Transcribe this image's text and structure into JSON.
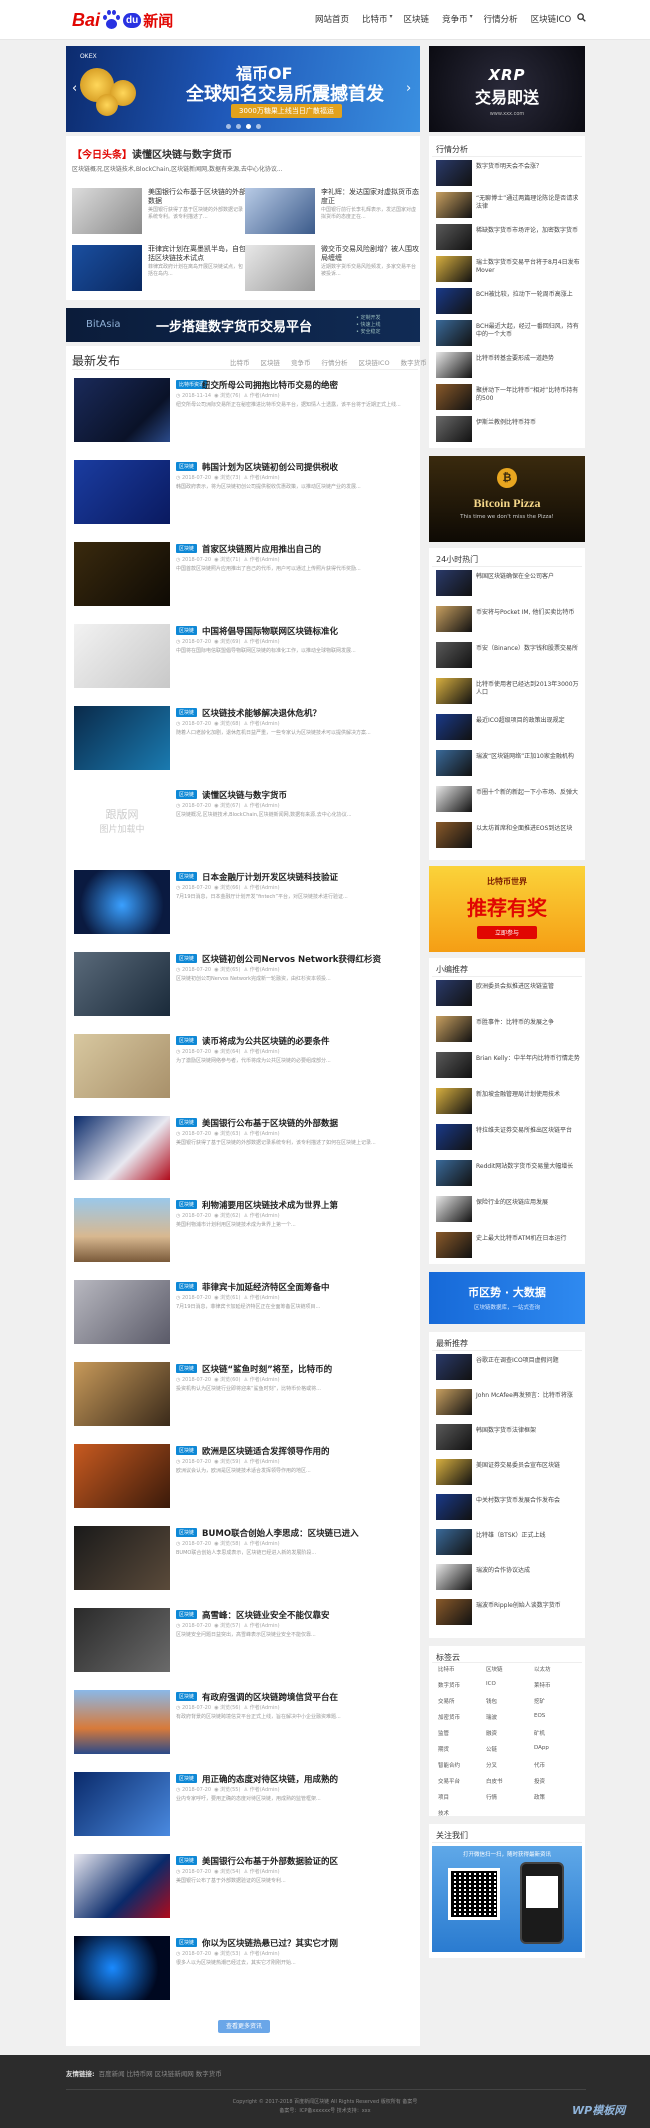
{
  "header": {
    "logo": {
      "bai": "Bai",
      "du": "du",
      "xw": "新闻"
    },
    "nav": [
      "网站首页",
      "比特币",
      "区块链",
      "竞争币",
      "行情分析",
      "区块链ICO"
    ],
    "nav_has_dropdown": [
      false,
      true,
      false,
      true,
      false,
      false
    ]
  },
  "hero": {
    "brand": "OKEX",
    "line1": "福币OF",
    "line2": "全球知名交易所震撼首发",
    "line3": "3000万糖果上线当日广散福运"
  },
  "xrp_ad": {
    "line1": "XRP",
    "line2": "交易即送",
    "line3": "www.xxx.com"
  },
  "headline": {
    "tag": "【今日头条】",
    "title": "读懂区块链与数字货币",
    "desc": "区块链概况,区块链技术,BlockChain,区块链新闻网,数据有来源,去中心化协议..."
  },
  "featured": [
    {
      "title": "美国银行公布基于区块链的外部数据",
      "desc": "美国银行获得了基于区块链的外部数据记录系统专利。该专利描述了..."
    },
    {
      "title": "李礼辉：发达国家对虚拟货币态度正",
      "desc": "中国银行前行长李礼辉表示，发达国家对虚拟货币的态度正在..."
    },
    {
      "title": "菲律宾计划在离墨凯半岛，自包括区块链技术试点",
      "desc": "菲律宾政府计划在离岛开展区块链试点，包括在岛内..."
    },
    {
      "title": "微交币交易风险剧增？被人围攻局缠缠",
      "desc": "近期数字货币交易风险频发，多家交易平台被投诉..."
    }
  ],
  "bitasia": {
    "brand": "BitAsia",
    "slogan": "一步搭建数字货币交易平台",
    "notes": "• 定制开发\n• 快速上线\n• 安全稳定"
  },
  "latest": {
    "title": "最新发布",
    "tabs": [
      "比特币",
      "区块链",
      "竞争币",
      "行情分析",
      "区块链ICO",
      "数字货币"
    ],
    "more_button": "查看更多资讯"
  },
  "articles": [
    {
      "cat": "比特币资讯",
      "title": "纽交所母公司拥抱比特币交易的绝密",
      "date": "2018-11-14",
      "views": "浏览(76)",
      "author": "作者(Admin)",
      "excerpt": "纽交所母公司洲际交易所正在秘密推进比特币交易平台，据知情人士透露，该平台将于近期正式上线..."
    },
    {
      "cat": "区块链",
      "title": "韩国计划为区块链初创公司提供税收",
      "date": "2018-07-20",
      "views": "浏览(73)",
      "author": "作者(Admin)",
      "excerpt": "韩国政府表示，将为区块链初创公司提供税收优惠政策，以推动区块链产业的发展..."
    },
    {
      "cat": "区块链",
      "title": "首家区块链照片应用推出自己的",
      "date": "2018-07-20",
      "views": "浏览(71)",
      "author": "作者(Admin)",
      "excerpt": "中国首款区块链照片应用推出了自己的代币，用户可以通过上传照片获得代币奖励..."
    },
    {
      "cat": "区块链",
      "title": "中国将倡导国际物联网区块链标准化",
      "date": "2018-07-20",
      "views": "浏览(69)",
      "author": "作者(Admin)",
      "excerpt": "中国将在国际电信联盟倡导物联网区块链的标准化工作，以推动全球物联网发展..."
    },
    {
      "cat": "区块链",
      "title": "区块链技术能够解决退休危机？",
      "date": "2018-07-20",
      "views": "浏览(68)",
      "author": "作者(Admin)",
      "excerpt": "随着人口老龄化加剧，退休危机日益严重，一些专家认为区块链技术可以提供解决方案..."
    },
    {
      "cat": "区块链",
      "title": "读懂区块链与数字货币",
      "date": "2018-07-20",
      "views": "浏览(67)",
      "author": "作者(Admin)",
      "excerpt": "区块链概况,区块链技术,BlockChain,区块链新闻网,数据有来源,去中心化协议..."
    },
    {
      "cat": "区块链",
      "title": "日本金融厅计划开发区块链科技验证",
      "date": "2018-07-20",
      "views": "浏览(66)",
      "author": "作者(Admin)",
      "excerpt": "7月19日消息，日本金融厅计划开发“fintech”平台，对区块链技术进行验证..."
    },
    {
      "cat": "区块链",
      "title": "区块链初创公司Nervos Network获得红杉资",
      "date": "2018-07-20",
      "views": "浏览(65)",
      "author": "作者(Admin)",
      "excerpt": "区块链初创公司Nervos Network完成新一轮融资，由红杉资本领投..."
    },
    {
      "cat": "区块链",
      "title": "读币将成为公共区块链的必要条件",
      "date": "2018-07-20",
      "views": "浏览(64)",
      "author": "作者(Admin)",
      "excerpt": "为了激励区块链网络参与者，代币将成为公共区块链的必要组成部分..."
    },
    {
      "cat": "区块链",
      "title": "美国银行公布基于区块链的外部数据",
      "date": "2018-07-20",
      "views": "浏览(63)",
      "author": "作者(Admin)",
      "excerpt": "美国银行获得了基于区块链的外部数据记录系统专利，该专利描述了如何在区块链上记录..."
    },
    {
      "cat": "区块链",
      "title": "利物浦要用区块链技术成为世界上第",
      "date": "2018-07-20",
      "views": "浏览(62)",
      "author": "作者(Admin)",
      "excerpt": "英国利物浦市计划利用区块链技术成为世界上第一个..."
    },
    {
      "cat": "区块链",
      "title": "菲律宾卡加延经济特区全面筹备中",
      "date": "2018-07-20",
      "views": "浏览(61)",
      "author": "作者(Admin)",
      "excerpt": "7月19日消息，菲律宾卡加延经济特区正在全面筹备区块链项目..."
    },
    {
      "cat": "区块链",
      "title": "区块链“鲨鱼时刻”将至，比特币的",
      "date": "2018-07-20",
      "views": "浏览(60)",
      "author": "作者(Admin)",
      "excerpt": "投资机构认为区块链行业即将迎来“鲨鱼时刻”，比特币价格或将..."
    },
    {
      "cat": "区块链",
      "title": "欧洲是区块链适合发挥领导作用的",
      "date": "2018-07-20",
      "views": "浏览(59)",
      "author": "作者(Admin)",
      "excerpt": "欧洲议会认为，欧洲是区块链技术适合发挥领导作用的地区..."
    },
    {
      "cat": "区块链",
      "title": "BUMO联合创始人李思成：区块链已进入",
      "date": "2018-07-20",
      "views": "浏览(58)",
      "author": "作者(Admin)",
      "excerpt": "BUMO联合创始人李思成表示，区块链已经进入新的发展阶段..."
    },
    {
      "cat": "区块链",
      "title": "高雪峰：区块链业安全不能仅靠安",
      "date": "2018-07-20",
      "views": "浏览(57)",
      "author": "作者(Admin)",
      "excerpt": "区块链安全问题日益突出，高雪峰表示区块链业安全不能仅靠..."
    },
    {
      "cat": "区块链",
      "title": "有政府强调的区块链跨境信贷平台在",
      "date": "2018-07-20",
      "views": "浏览(56)",
      "author": "作者(Admin)",
      "excerpt": "有政府背景的区块链跨境信贷平台正式上线，旨在解决中小企业融资难题..."
    },
    {
      "cat": "区块链",
      "title": "用正确的态度对待区块链，用成熟的",
      "date": "2018-07-20",
      "views": "浏览(55)",
      "author": "作者(Admin)",
      "excerpt": "业内专家呼吁，要用正确的态度对待区块链，用成熟的监管框架..."
    },
    {
      "cat": "区块链",
      "title": "美国银行公布基于外部数据验证的区",
      "date": "2018-07-20",
      "views": "浏览(54)",
      "author": "作者(Admin)",
      "excerpt": "美国银行公布了基于外部数据验证的区块链专利..."
    },
    {
      "cat": "区块链",
      "title": "你以为区块链热悬已过？其实它才刚",
      "date": "2018-07-20",
      "views": "浏览(53)",
      "author": "作者(Admin)",
      "excerpt": "很多人以为区块链热潮已经过去，其实它才刚刚开始..."
    }
  ],
  "sidebar": {
    "market_title": "行情分析",
    "market": [
      "数字货币明天会不会涨？",
      "“无聊博士”通过两篇理论陈论是否请求法律",
      "稀缺数字货币市场评论，加密数字货币",
      "瑞士数字货币交易平台将于8月4日发布Mover",
      "BCH被比较，拉动下一轮周币高涨上",
      "BCH最近大起，经过一番回归风，持有中的一个大币",
      "比特币转基金要形成一道趋势",
      "聚拼动下一年比特币“相对”比特币持有的500",
      "伊斯兰教例比特币持币"
    ],
    "pizza": {
      "title": "Bitcoin Pizza",
      "sub": "This time we don't miss the Pizza!"
    },
    "hot_title": "24小时热门",
    "hot": [
      "韩国区块链确保在全公司客户",
      "币安将与Pocket IM, 他们买卖比特币",
      "币安（Binance）数字钱和股票交易所",
      "比特币使用者已经达到2013年3000万人口",
      "最近ICO超级项目的政策出现规定",
      "瑞波“区块链网络”正加10家金融机构",
      "币圈十个新的新起一下小市场、反弹大",
      "以太坊首席和全面推进EOS到达区块"
    ],
    "promo": {
      "top": "比特币世界",
      "main": "推荐有奖",
      "sub": "立即参与"
    },
    "news_title": "小编推荐",
    "news": [
      "欧洲委员会拟推进区块链监管",
      "币胜事件：比特币的发展之争",
      "Brian Kelly：中半年内比特币行情走势",
      "新加坡金融管理局计划使用技术",
      "特拉维夫证券交易所推出区块链平台",
      "Reddit网站数字货币交易量大幅增长",
      "保险行业的区块链应用发展",
      "史上最大比特币ATM机在日本运行"
    ],
    "blue_banner": {
      "title": "币区势 · 大数据",
      "sub": "区块链数据库，一站式查询"
    },
    "recent_title": "最新推荐",
    "recent": [
      "谷歌正在调查ICO项目虚假问题",
      "John McAfee再发预言：比特币将涨",
      "韩国数字货币法律框架",
      "美国证券交易委员会宣布区块链",
      "中关村数字货币发展合作发布会",
      "比特雄（BTSK）正式上线",
      "瑞波的合作协议达成",
      "瑞波币Ripple创始人谈数字货币"
    ],
    "tags_title": "标签云",
    "tags": [
      "比特币",
      "区块链",
      "以太坊",
      "数字货币",
      "ICO",
      "莱特币",
      "交易所",
      "钱包",
      "挖矿",
      "加密货币",
      "瑞波",
      "EOS",
      "监管",
      "融资",
      "矿机",
      "期货",
      "公链",
      "DApp",
      "智能合约",
      "分叉",
      "代币",
      "交易平台",
      "白皮书",
      "投资",
      "项目",
      "行情",
      "政策",
      "技术"
    ],
    "follow_title": "关注我们",
    "follow_text": "打开微信扫一扫，随时获得最新资讯"
  },
  "footer": {
    "links_label": "友情链接:",
    "links": "百度新闻 比特币网 区块链新闻网 数字货币",
    "copyright": "Copyright © 2017-2018 百度新闻区块链 All Rights Reserved 版权所有 备案号",
    "icp": "备案号：ICP备xxxxxx号  技术支持：xxx",
    "watermark": "WP模板网"
  },
  "colors": {
    "accent": "#e10602",
    "link": "#0e88d6",
    "footer": "#2c2c2c"
  }
}
